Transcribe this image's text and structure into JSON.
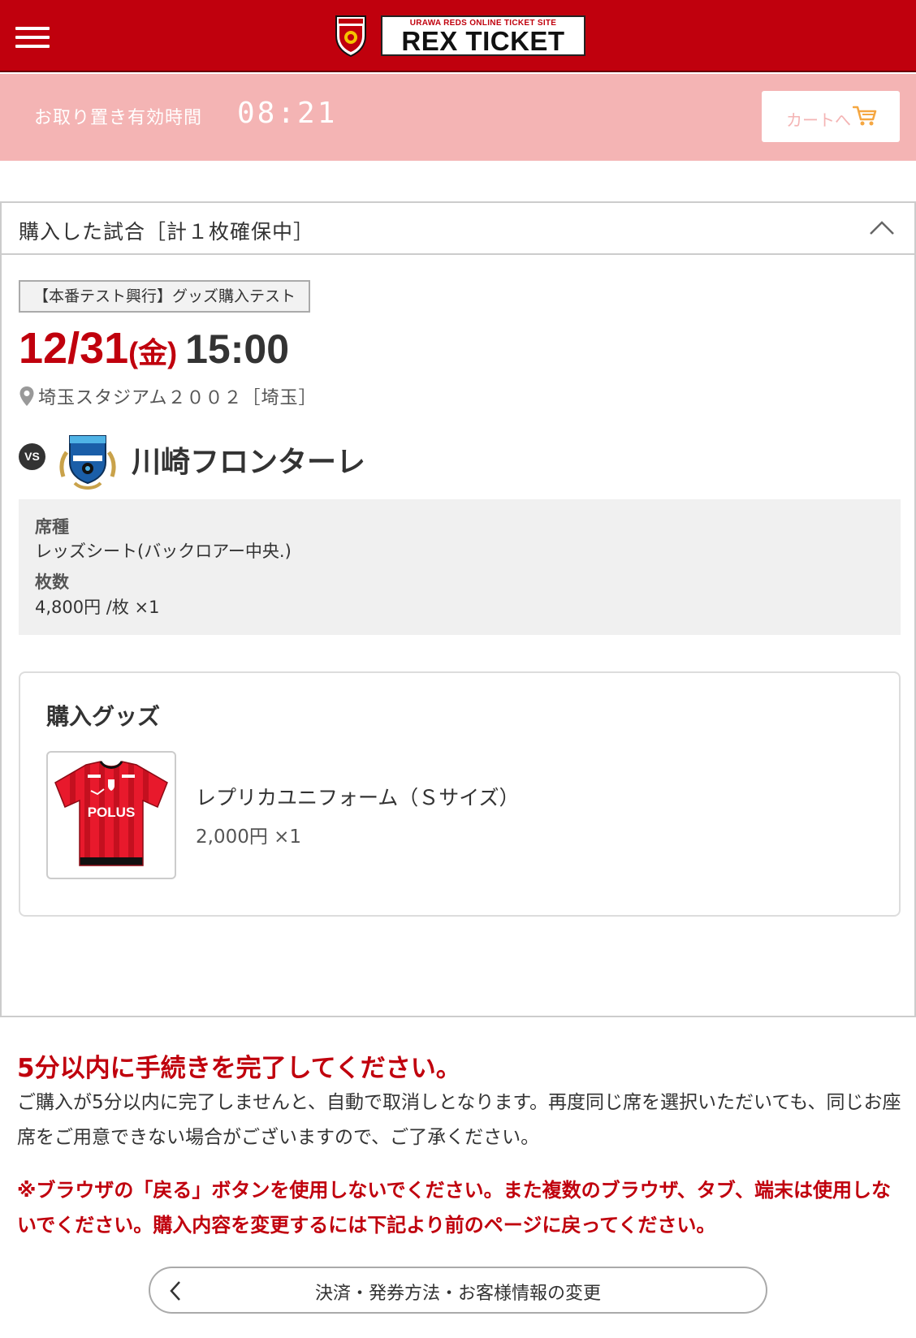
{
  "header": {
    "site_tagline": "URAWA REDS ONLINE TICKET SITE",
    "site_name": "REX TICKET",
    "menu_icon": "hamburger-menu-icon",
    "brand_color": "#c0000d"
  },
  "timer": {
    "label": "お取り置き有効時間",
    "value": "08:21",
    "cart_button_label": "カートへ",
    "cart_icon": "cart-icon",
    "bar_color": "#f4b4b4"
  },
  "panel": {
    "title": "購入した試合［計１枚確保中］",
    "collapse_icon": "chevron-up-icon",
    "event_tag": "【本番テスト興行】グッズ購入テスト",
    "date": "12/31",
    "day_of_week": "(金)",
    "time": "15:00",
    "venue": "埼玉スタジアム２００２［埼玉］",
    "vs_label": "VS",
    "opponent": "川崎フロンターレ",
    "seat": {
      "type_label": "席種",
      "type_value": "レッズシート(バックロアー中央.)",
      "count_label": "枚数",
      "count_value": "4,800円 /枚 ×1"
    },
    "goods": {
      "title": "購入グッズ",
      "items": [
        {
          "name": "レプリカユニフォーム（Ｓサイズ）",
          "price": "2,000円 ×1",
          "sponsor_text": "POLUS"
        }
      ]
    }
  },
  "notice": {
    "heading": "5分以内に手続きを完了してください。",
    "body": "ご購入が5分以内に完了しませんと、自動で取消しとなります。再度同じ席を選択いただいても、同じお座席をご用意できない場合がございますので、ご了承ください。",
    "warning": "※ブラウザの「戻る」ボタンを使用しないでください。また複数のブラウザ、タブ、端末は使用しないでください。購入内容を変更するには下記より前のページに戻ってください。"
  },
  "back_button": {
    "label": "決済・発券方法・お客様情報の変更",
    "icon": "chevron-left-icon"
  }
}
